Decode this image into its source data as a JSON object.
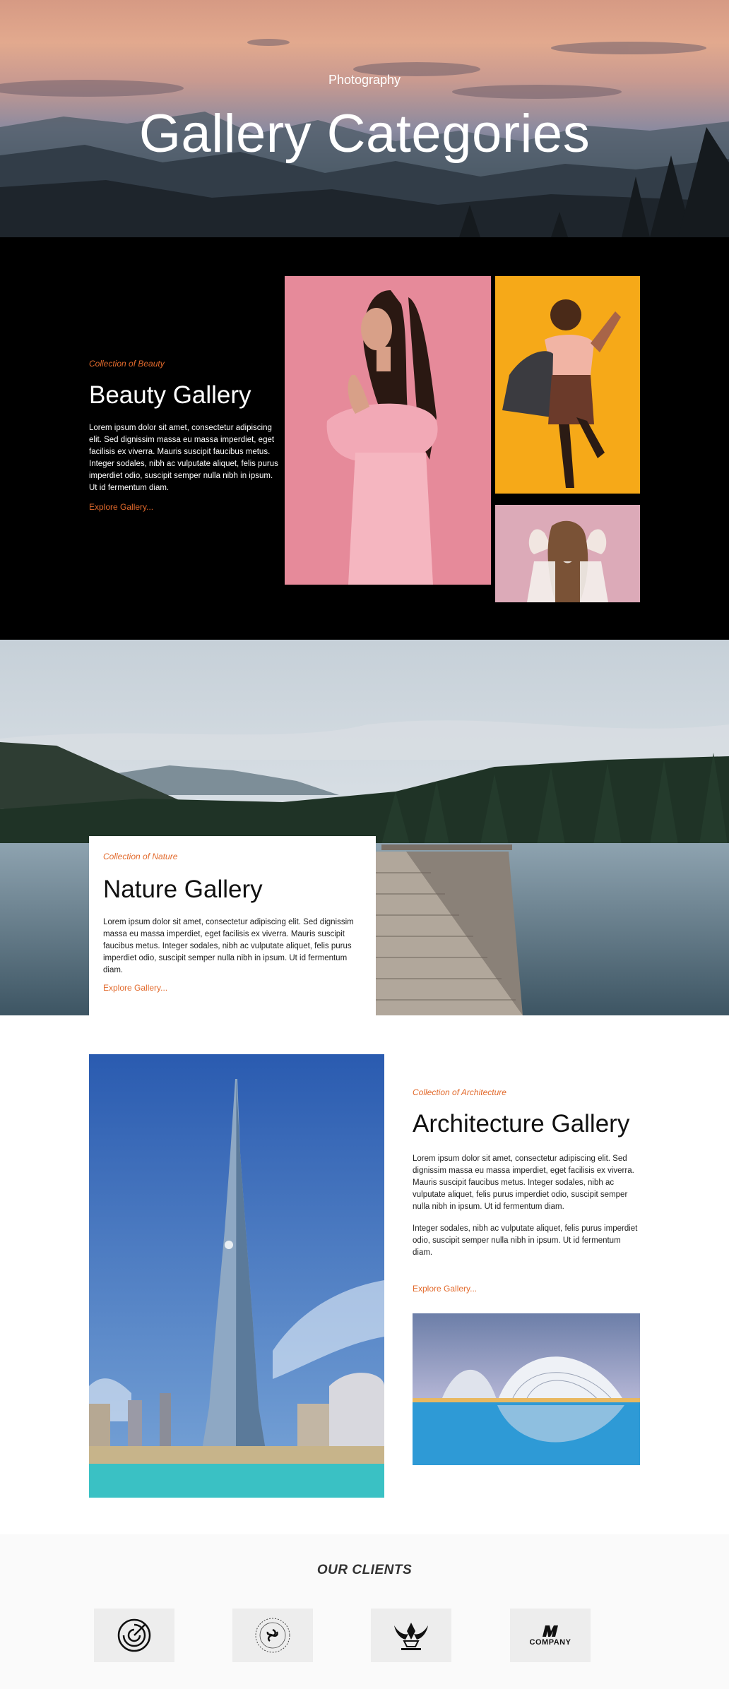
{
  "hero": {
    "kicker": "Photography",
    "title": "Gallery Categories"
  },
  "beauty": {
    "kicker": "Collection of Beauty",
    "title": "Beauty Gallery",
    "body": "Lorem ipsum dolor sit amet, consectetur adipiscing elit. Sed dignissim massa eu massa imperdiet, eget facilisis ex viverra. Mauris suscipit faucibus metus. Integer sodales, nibh ac vulputate aliquet, felis purus imperdiet odio, suscipit semper nulla nibh in ipsum. Ut id fermentum diam.",
    "link": "Explore Gallery..."
  },
  "nature": {
    "kicker": "Collection of Nature",
    "title": "Nature Gallery",
    "body": "Lorem ipsum dolor sit amet, consectetur adipiscing elit. Sed dignissim massa eu massa imperdiet, eget facilisis ex viverra. Mauris suscipit faucibus metus. Integer sodales, nibh ac vulputate aliquet, felis purus imperdiet odio, suscipit semper nulla nibh in ipsum. Ut id fermentum diam.",
    "link": "Explore Gallery..."
  },
  "architecture": {
    "kicker": "Collection of Architecture",
    "title": "Architecture Gallery",
    "body1": "Lorem ipsum dolor sit amet, consectetur adipiscing elit. Sed dignissim massa eu massa imperdiet, eget facilisis ex viverra. Mauris suscipit faucibus metus. Integer sodales, nibh ac vulputate aliquet, felis purus imperdiet odio, suscipit semper nulla nibh in ipsum. Ut id fermentum diam.",
    "body2": "Integer sodales, nibh ac vulputate aliquet, felis purus imperdiet odio, suscipit semper nulla nibh in ipsum. Ut id fermentum diam.",
    "link": "Explore Gallery..."
  },
  "clients": {
    "title": "OUR CLIENTS",
    "logos": [
      {
        "icon": "circle-maze-logo"
      },
      {
        "icon": "triskelion-ring-logo"
      },
      {
        "icon": "winged-emblem-logo"
      },
      {
        "icon": "company-monogram-logo",
        "text": "COMPANY"
      }
    ]
  },
  "colors": {
    "accent": "#e26a2c",
    "beauty_bg": "#000000"
  }
}
